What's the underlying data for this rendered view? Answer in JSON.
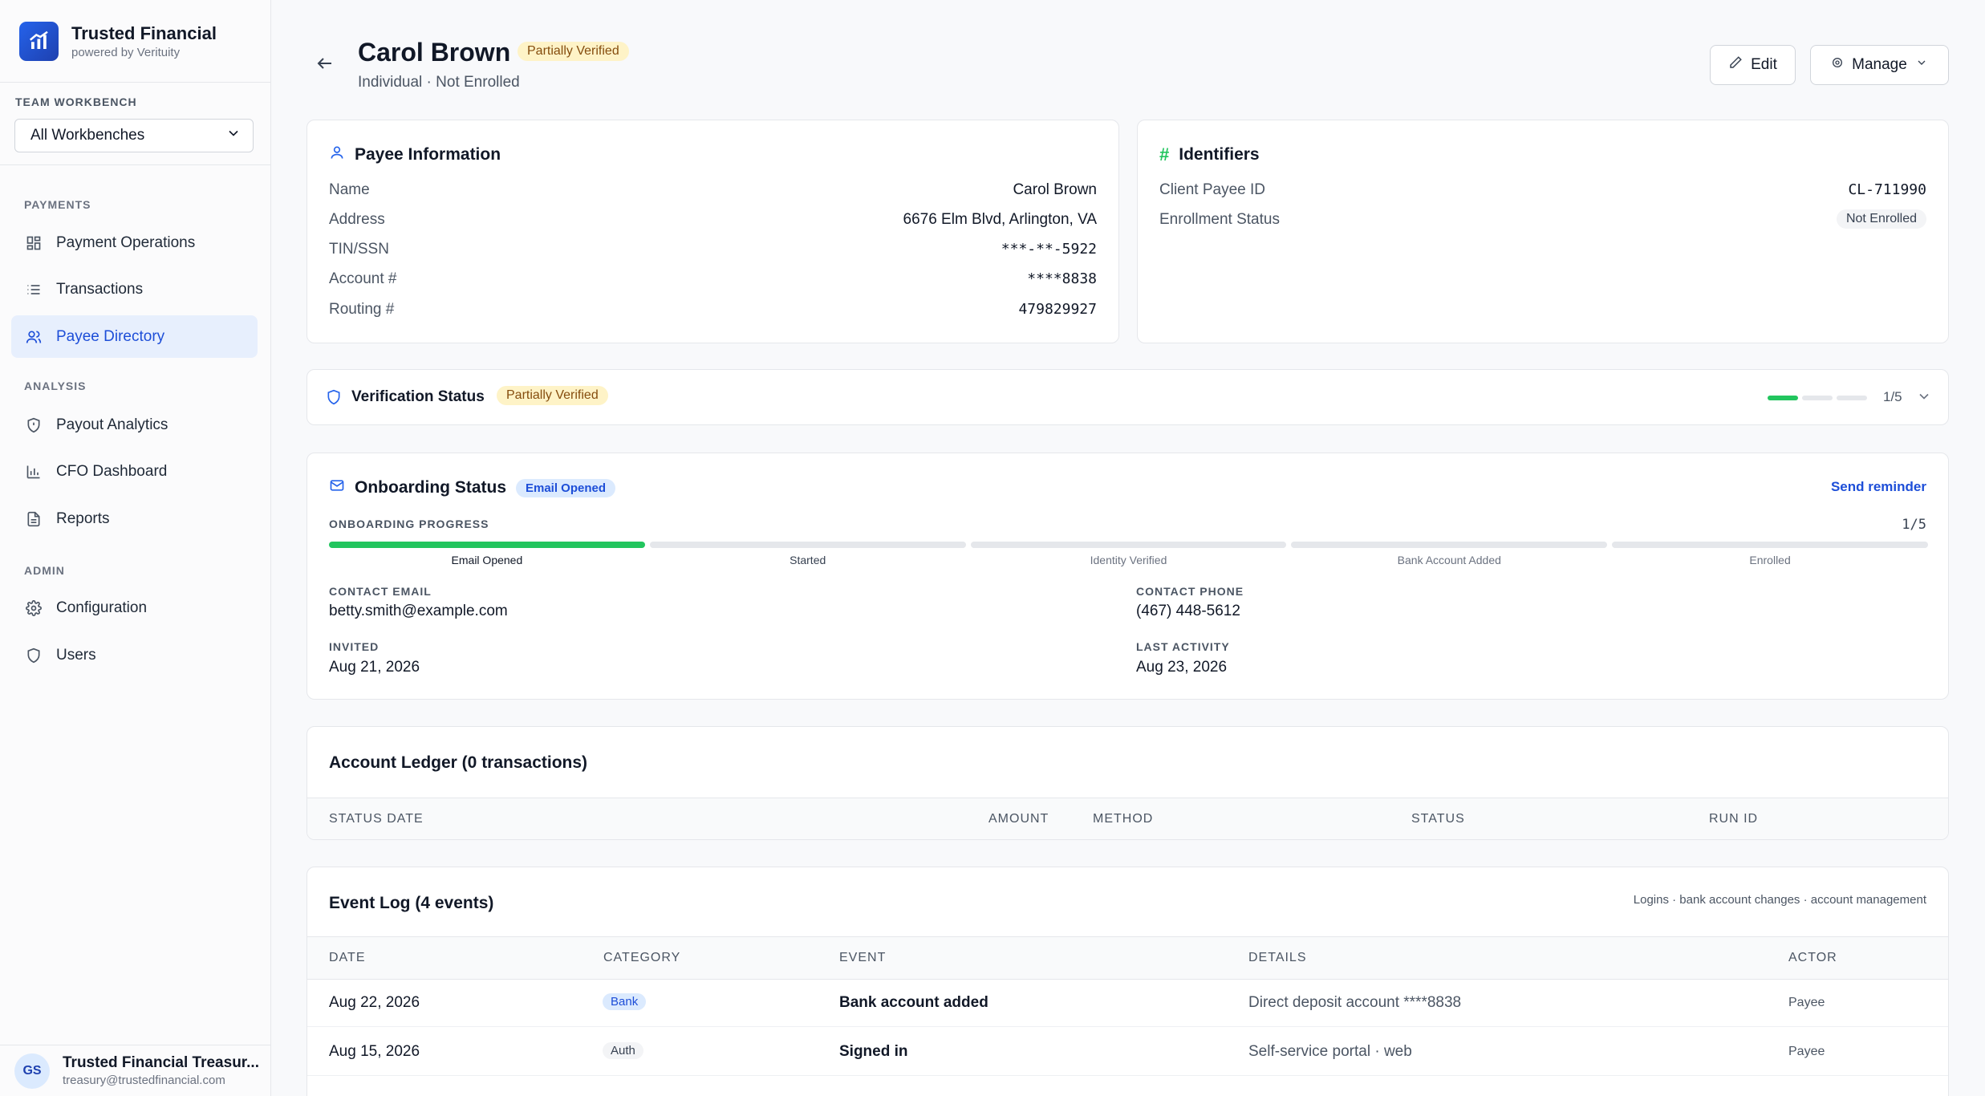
{
  "brand": {
    "title": "Trusted Financial",
    "subtitle": "powered by Verituity"
  },
  "workbench": {
    "label": "TEAM WORKBENCH",
    "selected": "All Workbenches"
  },
  "nav": {
    "payments_label": "PAYMENTS",
    "payment_operations": "Payment Operations",
    "transactions": "Transactions",
    "payee_directory": "Payee Directory",
    "analysis_label": "ANALYSIS",
    "payout_analytics": "Payout Analytics",
    "cfo_dashboard": "CFO Dashboard",
    "reports": "Reports",
    "admin_label": "ADMIN",
    "configuration": "Configuration",
    "users": "Users"
  },
  "user": {
    "initials": "GS",
    "name": "Trusted Financial Treasur...",
    "email": "treasury@trustedfinancial.com"
  },
  "header": {
    "name": "Carol Brown",
    "badge": "Partially Verified",
    "subtitle": "Individual · Not Enrolled",
    "edit_label": "Edit",
    "manage_label": "Manage"
  },
  "payee_info": {
    "title": "Payee Information",
    "rows": [
      {
        "label": "Name",
        "value": "Carol Brown"
      },
      {
        "label": "Address",
        "value": "6676 Elm Blvd, Arlington, VA"
      },
      {
        "label": "TIN/SSN",
        "value": "***-**-5922"
      },
      {
        "label": "Account #",
        "value": "****8838"
      },
      {
        "label": "Routing #",
        "value": "479829927"
      }
    ]
  },
  "identifiers": {
    "title": "Identifiers",
    "client_payee_id_label": "Client Payee ID",
    "client_payee_id": "CL-711990",
    "enrollment_status_label": "Enrollment Status",
    "enrollment_status": "Not Enrolled"
  },
  "verification": {
    "title": "Verification Status",
    "badge": "Partially Verified",
    "count": "1/5",
    "segments_complete": 1,
    "segments_total": 3
  },
  "onboarding": {
    "title": "Onboarding Status",
    "badge": "Email Opened",
    "send_reminder": "Send reminder",
    "progress_label": "ONBOARDING PROGRESS",
    "progress_count": "1/5",
    "steps": [
      "Email Opened",
      "Started",
      "Identity Verified",
      "Bank Account Added",
      "Enrolled"
    ],
    "steps_complete": 1,
    "contact_email_label": "CONTACT EMAIL",
    "contact_email": "betty.smith@example.com",
    "contact_phone_label": "CONTACT PHONE",
    "contact_phone": "(467) 448-5612",
    "invited_label": "INVITED",
    "invited": "Aug 21, 2026",
    "last_activity_label": "LAST ACTIVITY",
    "last_activity": "Aug 23, 2026"
  },
  "ledger": {
    "title": "Account Ledger (0 transactions)",
    "columns": [
      "STATUS DATE",
      "AMOUNT",
      "METHOD",
      "STATUS",
      "RUN ID"
    ]
  },
  "event_log": {
    "title": "Event Log (4 events)",
    "subtitle": "Logins · bank account changes · account management",
    "columns": [
      "DATE",
      "CATEGORY",
      "EVENT",
      "DETAILS",
      "ACTOR"
    ],
    "rows": [
      {
        "date": "Aug 22, 2026",
        "category": "Bank",
        "event": "Bank account added",
        "details": "Direct deposit account ****8838",
        "actor": "Payee"
      },
      {
        "date": "Aug 15, 2026",
        "category": "Auth",
        "event": "Signed in",
        "details": "Self-service portal · web",
        "actor": "Payee"
      }
    ]
  },
  "colors": {
    "accent": "#1d4ed8",
    "success": "#22c55e",
    "warning_bg": "#fef3c7"
  }
}
